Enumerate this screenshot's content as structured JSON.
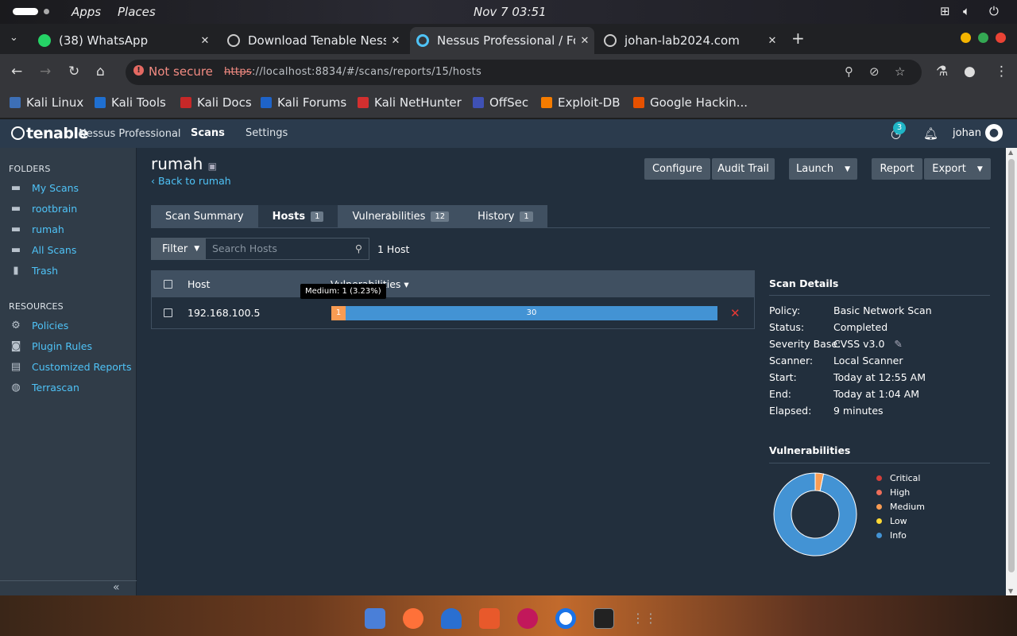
{
  "os_bar": {
    "apps": "Apps",
    "places": "Places",
    "clock": "Nov 7  03:51"
  },
  "browser": {
    "tabs": [
      {
        "title": "(38) WhatsApp",
        "favicon_color": "#25d366",
        "active": false
      },
      {
        "title": "Download Tenable Ness",
        "favicon_color": "#cccccc",
        "active": false
      },
      {
        "title": "Nessus Professional / Fo",
        "favicon_color": "#4fc3f7",
        "active": true
      },
      {
        "title": "johan-lab2024.com",
        "favicon_color": "#cccccc",
        "active": false
      }
    ],
    "not_secure": "Not secure",
    "url_scheme": "https",
    "url_rest": "://localhost:8834/#/scans/reports/15/hosts",
    "bookmarks": [
      {
        "label": "Kali Linux",
        "color": "#3d6fb6"
      },
      {
        "label": "Kali Tools",
        "color": "#1f6fd0"
      },
      {
        "label": "Kali Docs",
        "color": "#c62828"
      },
      {
        "label": "Kali Forums",
        "color": "#1e63c9"
      },
      {
        "label": "Kali NetHunter",
        "color": "#d32f2f"
      },
      {
        "label": "OffSec",
        "color": "#3f51b5"
      },
      {
        "label": "Exploit-DB",
        "color": "#f57c00"
      },
      {
        "label": "Google Hackin...",
        "color": "#e65100"
      }
    ]
  },
  "nessus": {
    "brand": "tenable",
    "product": "Nessus Professional",
    "nav": [
      "Scans",
      "Settings"
    ],
    "notification_count": "3",
    "user": "johan"
  },
  "sidebar": {
    "folders_heading": "FOLDERS",
    "folders": [
      {
        "label": "My Scans",
        "icon": "folder-icon"
      },
      {
        "label": "rootbrain",
        "icon": "folder-icon"
      },
      {
        "label": "rumah",
        "icon": "folder-icon"
      },
      {
        "label": "All Scans",
        "icon": "folder-icon"
      },
      {
        "label": "Trash",
        "icon": "trash-icon"
      }
    ],
    "resources_heading": "RESOURCES",
    "resources": [
      {
        "label": "Policies",
        "icon": "gear-icon"
      },
      {
        "label": "Plugin Rules",
        "icon": "plugin-icon"
      },
      {
        "label": "Customized Reports",
        "icon": "report-icon"
      },
      {
        "label": "Terrascan",
        "icon": "terrascan-icon"
      }
    ]
  },
  "scan": {
    "title": "rumah",
    "back_link": "Back to rumah",
    "buttons": {
      "configure": "Configure",
      "audit_trail": "Audit Trail",
      "launch": "Launch",
      "report": "Report",
      "export": "Export"
    },
    "tabs": [
      {
        "label": "Scan Summary",
        "count": ""
      },
      {
        "label": "Hosts",
        "count": "1"
      },
      {
        "label": "Vulnerabilities",
        "count": "12"
      },
      {
        "label": "History",
        "count": "1"
      }
    ],
    "filter_label": "Filter",
    "search_placeholder": "Search Hosts",
    "host_count": "1 Host",
    "table": {
      "col_host": "Host",
      "col_vulns": "Vulnerabilities ▾",
      "rows": [
        {
          "host": "192.168.100.5",
          "medium": 1,
          "info": 30,
          "medium_label": "1",
          "info_label": "30"
        }
      ]
    },
    "tooltip": "Medium: 1 (3.23%)"
  },
  "scan_details": {
    "heading": "Scan Details",
    "fields": [
      {
        "label": "Policy:",
        "value": "Basic Network Scan"
      },
      {
        "label": "Status:",
        "value": "Completed"
      },
      {
        "label": "Severity Base:",
        "value": "CVSS v3.0"
      },
      {
        "label": "Scanner:",
        "value": "Local Scanner"
      },
      {
        "label": "Start:",
        "value": "Today at 12:55 AM"
      },
      {
        "label": "End:",
        "value": "Today at 1:04 AM"
      },
      {
        "label": "Elapsed:",
        "value": "9 minutes"
      }
    ]
  },
  "vuln_chart": {
    "heading": "Vulnerabilities",
    "legend": [
      {
        "label": "Critical",
        "color": "#d43f3a",
        "count": 0
      },
      {
        "label": "High",
        "color": "#ee6e5a",
        "count": 0
      },
      {
        "label": "Medium",
        "color": "#f99c53",
        "count": 1
      },
      {
        "label": "Low",
        "color": "#fdd835",
        "count": 0
      },
      {
        "label": "Info",
        "color": "#4393d4",
        "count": 30
      }
    ]
  }
}
